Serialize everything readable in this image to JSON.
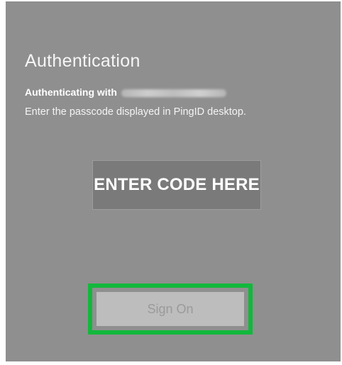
{
  "page": {
    "title": "Authentication",
    "authenticating_label": "Authenticating with",
    "instructions": "Enter the passcode displayed in PingID desktop."
  },
  "code_entry": {
    "label": "ENTER CODE HERE"
  },
  "actions": {
    "sign_on_label": "Sign On"
  },
  "colors": {
    "panel_background": "#8f8f8f",
    "code_box_background": "#7a7a7a",
    "sign_on_background": "#bdbdbd",
    "highlight": "#12b83c"
  }
}
